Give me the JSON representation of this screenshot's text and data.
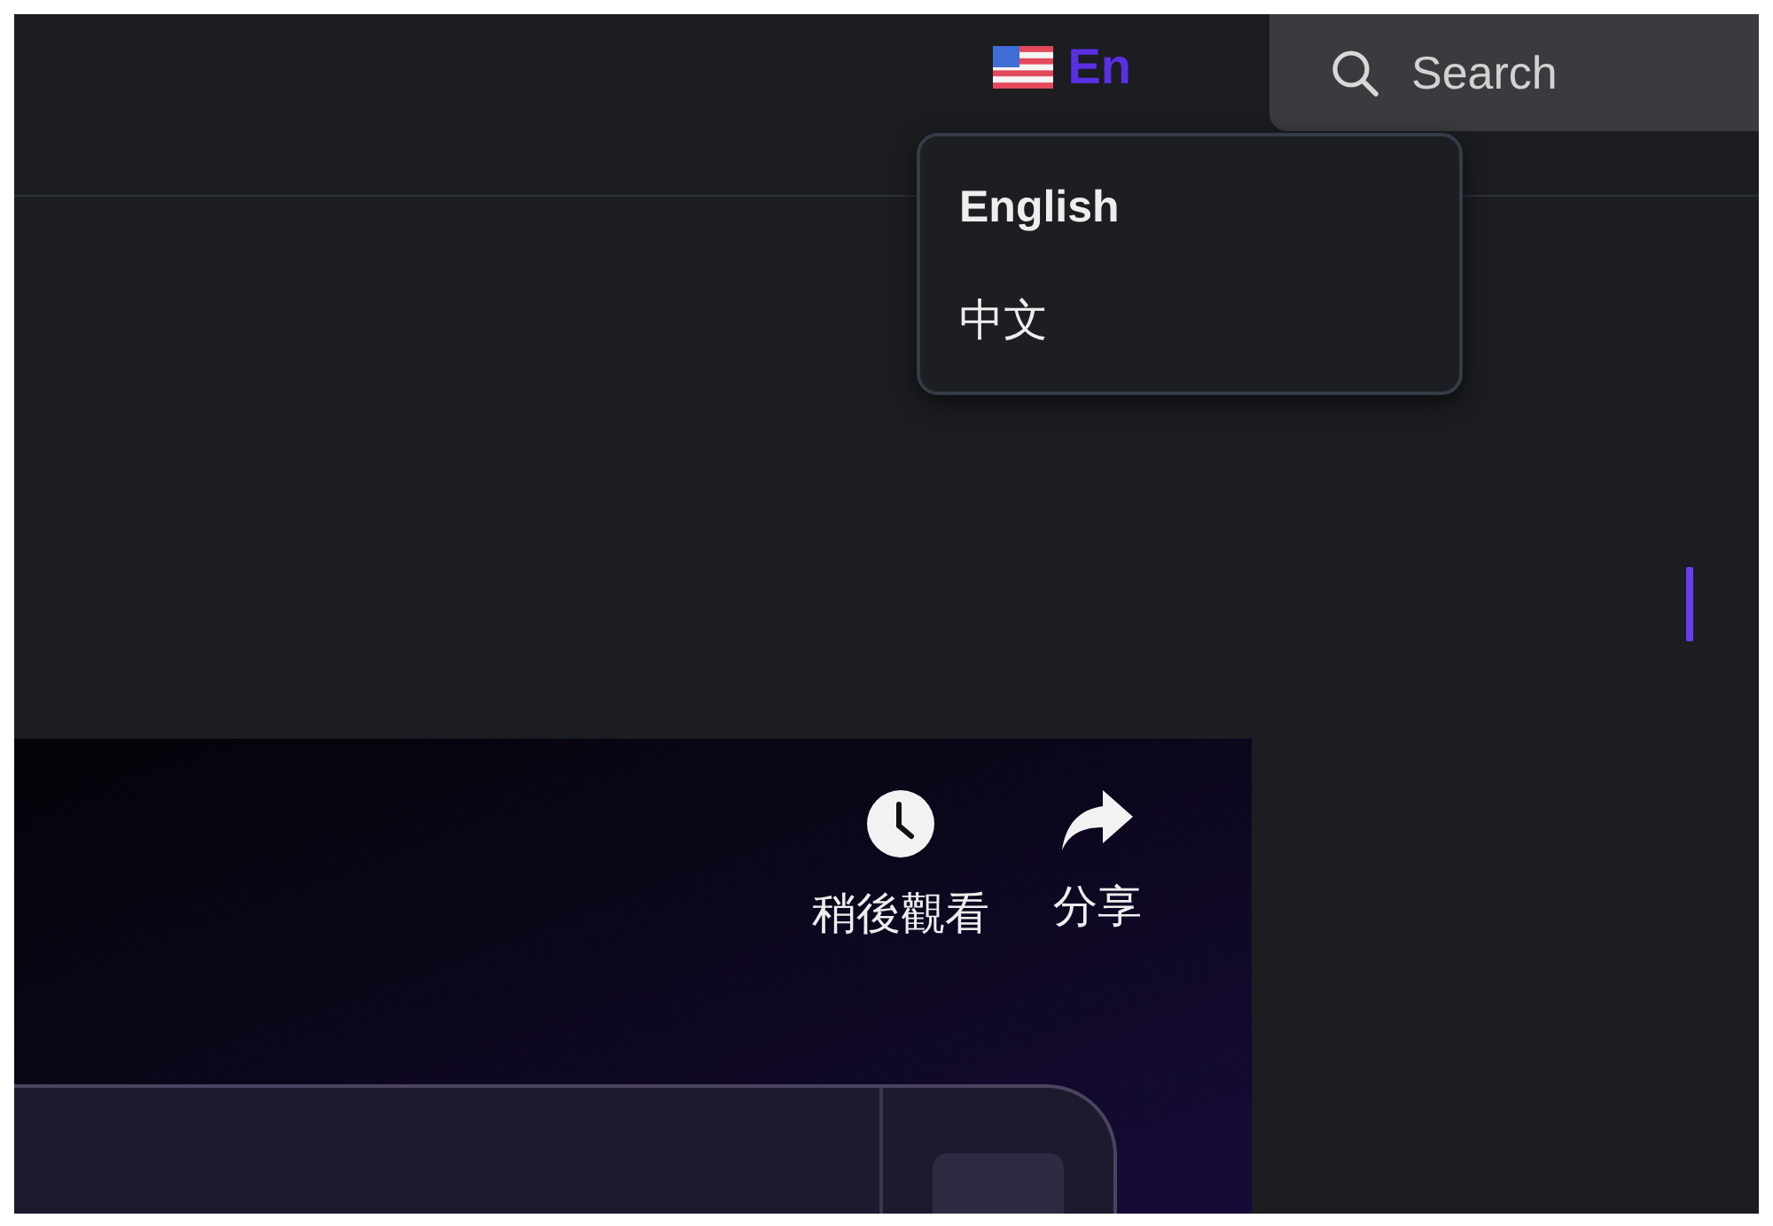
{
  "header": {
    "language_switcher": {
      "label": "En"
    },
    "search": {
      "placeholder": "Search"
    }
  },
  "language_menu": {
    "items": [
      {
        "label": "English",
        "selected": true
      },
      {
        "label": "中文",
        "selected": false
      }
    ]
  },
  "video": {
    "actions": [
      {
        "kind": "watch_later",
        "label": "稍後觀看"
      },
      {
        "kind": "share",
        "label": "分享"
      }
    ]
  }
}
